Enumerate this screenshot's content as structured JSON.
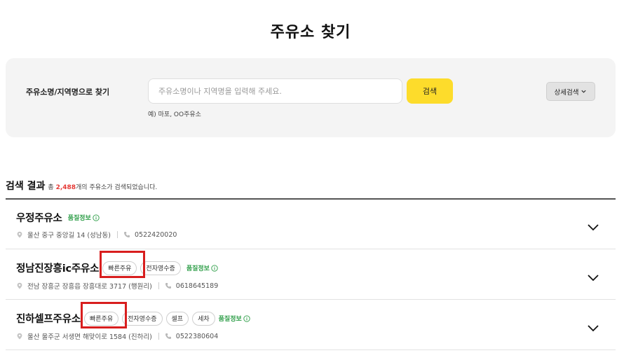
{
  "page": {
    "title": "주유소 찾기"
  },
  "search": {
    "label": "주유소명/지역명으로 찾기",
    "placeholder": "주유소명이나 지역명을 입력해 주세요.",
    "value": "",
    "button_label": "검색",
    "hint": "예) 마포, OO주유소",
    "detail_button_label": "상세검색"
  },
  "results": {
    "title": "검색 결과",
    "summary_prefix": "총",
    "count": "2,488",
    "summary_suffix": "개의 주유소가 검색되었습니다."
  },
  "stations": [
    {
      "name": "우정주유소",
      "tags": [],
      "quality_label": "품질정보",
      "address": "울산 중구 중앙길 14 (성남동)",
      "phone": "0522420020"
    },
    {
      "name": "정남진장흥ic주유소",
      "tags": [
        "빠른주유",
        "전자영수증"
      ],
      "quality_label": "품질정보",
      "address": "전남 장흥군 장흥읍 장흥대로 3717 (행원리)",
      "phone": "0618645189"
    },
    {
      "name": "진하셀프주유소",
      "tags": [
        "빠른주유",
        "전자영수증",
        "셀프",
        "세차"
      ],
      "quality_label": "품질정보",
      "address": "울산 울주군 서생면 해맞이로 1584 (진하리)",
      "phone": "0522380604"
    }
  ],
  "icons": {
    "pin": "location-pin-icon",
    "phone": "phone-icon",
    "info": "info-circle-icon",
    "expand": "chevron-down-icon"
  },
  "colors": {
    "accent_yellow": "#fddc2b",
    "count_red": "#e53935",
    "quality_green": "#2e9e48",
    "highlight_red": "#d81e1e",
    "panel_gray": "#f4f4f4"
  }
}
